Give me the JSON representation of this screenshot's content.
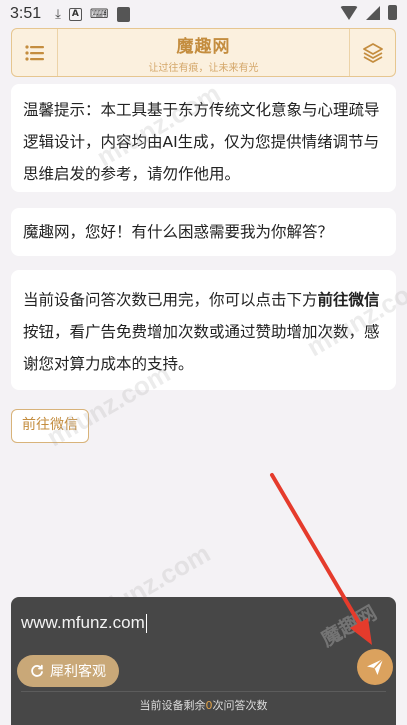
{
  "status_bar": {
    "time": "3:51"
  },
  "header": {
    "title": "魔趣网",
    "subtitle": "让过往有痕，让未来有光"
  },
  "messages": {
    "notice": "温馨提示：本工具基于东方传统文化意象与心理疏导逻辑设计，内容均由AI生成，仅为您提供情绪调节与思维启发的参考，请勿作他用。",
    "greeting": "魔趣网，您好！有什么困惑需要我为你解答？",
    "quota_prefix": "当前设备问答次数已用完，你可以点击下方",
    "quota_bold": "前往微信",
    "quota_suffix": "按钮，看广告免费增加次数或通过赞助增加次数，感谢您对算力成本的支持。"
  },
  "wechat_button": {
    "label": "前往微信"
  },
  "input": {
    "value": "www.mfunz.com",
    "keli_label": "犀利客观",
    "remaining_prefix": "当前设备剩余",
    "remaining_count": "0",
    "remaining_suffix": "次问答次数"
  },
  "watermark": {
    "site": "mfunz.com",
    "name": "魔趣网"
  },
  "colors": {
    "accent": "#c48d3f",
    "header_bg": "#fbf0de",
    "panel_bg": "#474747",
    "send_bg": "#dba25e",
    "arrow": "#e53b2c"
  },
  "icons": {
    "menu": "menu-icon",
    "layers": "layers-icon",
    "send": "paper-plane-icon",
    "refresh": "refresh-icon"
  }
}
